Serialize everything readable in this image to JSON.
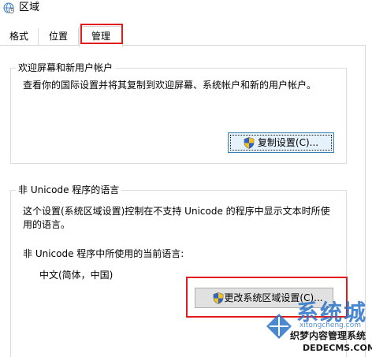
{
  "window": {
    "title": "区域",
    "title_icon": "globe-clock-icon"
  },
  "tabs": [
    {
      "label": "格式",
      "selected": false
    },
    {
      "label": "位置",
      "selected": false
    },
    {
      "label": "管理",
      "selected": true
    }
  ],
  "welcome_group": {
    "title": "欢迎屏幕和新用户帐户",
    "description": "查看你的国际设置并将其复制到欢迎屏幕、系统帐户和新的用户帐户。",
    "copy_button_label": "复制设置(C)...",
    "copy_button_icon": "uac-shield-icon"
  },
  "unicode_group": {
    "title": "非 Unicode 程序的语言",
    "description_line1": "这个设置(系统区域设置)控制在不支持 Unicode 的程序中显示文本时所使",
    "description_line2": "用的语言。",
    "current_label": "非 Unicode 程序中所使用的当前语言:",
    "current_value": "中文(简体，中国)",
    "change_button_label": "更改系统区域设置(C)...",
    "change_button_icon": "uac-shield-icon"
  },
  "highlight_color": "#e11a1a",
  "watermark": {
    "brand": "系统城",
    "url": "xitongcheng.com",
    "line1": "织梦内容管理系统",
    "line2": "DEDECMS.COM"
  }
}
